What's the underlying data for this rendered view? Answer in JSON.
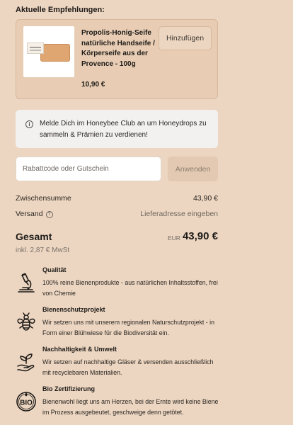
{
  "recommendations": {
    "title": "Aktuelle Empfehlungen:",
    "product": {
      "name": "Propolis-Honig-Seife natürliche Handseife / Körperseife aus der Provence - 100g",
      "price": "10,90 €",
      "add_label": "Hinzufügen"
    }
  },
  "club_notice": {
    "text": "Melde Dich im Honeybee Club an um Honeydrops zu sammeln & Prämien zu verdienen!"
  },
  "coupon": {
    "placeholder": "Rabattcode oder Gutschein",
    "apply_label": "Anwenden"
  },
  "summary": {
    "subtotal_label": "Zwischensumme",
    "subtotal_value": "43,90 €",
    "shipping_label": "Versand",
    "shipping_value": "Lieferadresse eingeben",
    "total_label": "Gesamt",
    "currency": "EUR",
    "total_value": "43,90 €",
    "tax_note": "inkl. 2,87 € MwSt"
  },
  "features": [
    {
      "icon": "microscope-icon",
      "title": "Qualität",
      "description": "100% reine Bienenprodukte - aus natürlichen Inhaltsstoffen, frei von Chemie"
    },
    {
      "icon": "bee-icon",
      "title": "Bienenschutzprojekt",
      "description": "Wir setzen uns mit unserem regionalen Naturschutzprojekt - in Form einer Blühwiese für die Biodiversität ein."
    },
    {
      "icon": "hand-plant-icon",
      "title": "Nachhaltigkeit & Umwelt",
      "description": "Wir setzen auf nachhaltige Gläser & versenden ausschließlich mit recyclebaren Materialien."
    },
    {
      "icon": "bio-seal-icon",
      "title": "Bio Zertifizierung",
      "description": "Bienenwohl liegt uns am Herzen, bei der Ernte wird keine Biene im Prozess ausgebeutet, geschweige denn getötet."
    }
  ]
}
